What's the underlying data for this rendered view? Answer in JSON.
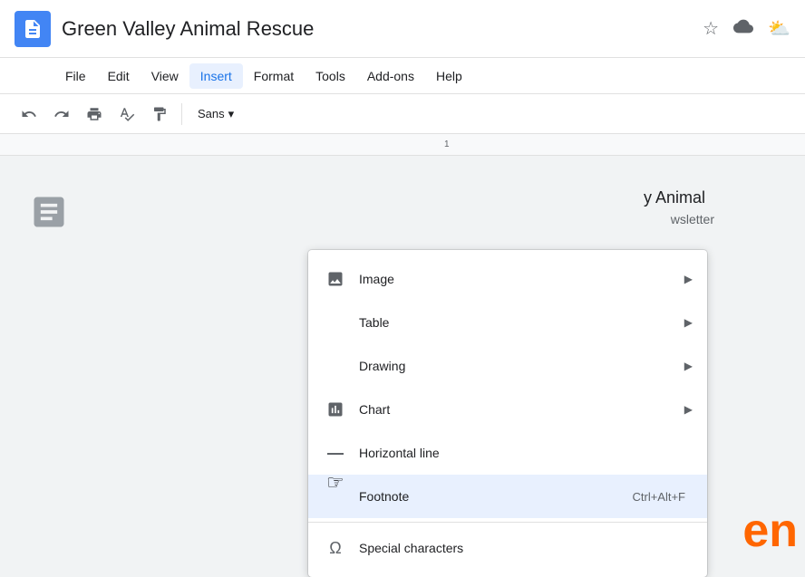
{
  "titleBar": {
    "title": "Green Valley Animal Rescue",
    "starIcon": "★",
    "driveIcon": "◆",
    "cloudIcon": "☁"
  },
  "menuBar": {
    "items": [
      {
        "label": "File",
        "active": false
      },
      {
        "label": "Edit",
        "active": false
      },
      {
        "label": "View",
        "active": false
      },
      {
        "label": "Insert",
        "active": true
      },
      {
        "label": "Format",
        "active": false
      },
      {
        "label": "Tools",
        "active": false
      },
      {
        "label": "Add-ons",
        "active": false
      },
      {
        "label": "Help",
        "active": false
      }
    ]
  },
  "toolbar": {
    "undoLabel": "↺",
    "redoLabel": "↻",
    "printLabel": "🖨",
    "spellcheckLabel": "A̲",
    "paintFormatLabel": "🖌",
    "fontName": "Sans",
    "fontDropdownArrow": "▾"
  },
  "dropdown": {
    "items": [
      {
        "id": "image",
        "label": "Image",
        "hasArrow": true,
        "hasIcon": true,
        "iconType": "image"
      },
      {
        "id": "table",
        "label": "Table",
        "hasArrow": true,
        "hasIcon": false,
        "iconType": null
      },
      {
        "id": "drawing",
        "label": "Drawing",
        "hasArrow": true,
        "hasIcon": false,
        "iconType": null
      },
      {
        "id": "chart",
        "label": "Chart",
        "hasArrow": true,
        "hasIcon": true,
        "iconType": "chart"
      },
      {
        "id": "horizontal-line",
        "label": "Horizontal line",
        "hasArrow": false,
        "hasIcon": true,
        "iconType": "line"
      },
      {
        "id": "footnote",
        "label": "Footnote",
        "shortcut": "Ctrl+Alt+F",
        "hasArrow": false,
        "hasIcon": false,
        "iconType": null,
        "highlighted": true
      },
      {
        "id": "special-characters",
        "label": "Special characters",
        "hasArrow": false,
        "hasIcon": true,
        "iconType": "omega"
      }
    ]
  },
  "docPreview": {
    "line1": "y Animal",
    "line2": "wsletter"
  },
  "ruler": {
    "number": "1"
  },
  "langIndicator": "en"
}
